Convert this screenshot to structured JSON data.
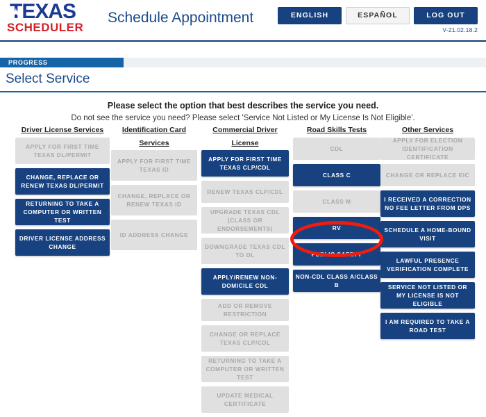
{
  "header": {
    "logo_texas": "TEXAS",
    "logo_star": "★",
    "logo_scheduler": "SCHEDULER",
    "page_heading": "Schedule Appointment",
    "english_label": "ENGLISH",
    "espanol_label": "ESPAÑOL",
    "logout_label": "LOG OUT",
    "version": "V-21.02.18.2",
    "accent_blue": "#18427f",
    "accent_red": "#d42027"
  },
  "progress": {
    "label": "PROGRESS",
    "section_title": "Select Service",
    "fill_percent": 25,
    "fill_color": "#1664a8"
  },
  "instructions": {
    "main": "Please select the option that best describes the service you need.",
    "sub": "Do not see the service you need? Please select 'Service Not Listed or My License Is Not Eligible'."
  },
  "annotation": {
    "type": "ellipse-highlight",
    "target": "RV",
    "color": "#f21c0d"
  },
  "columns": [
    {
      "id": "driver-license-services",
      "heading": "Driver License Services",
      "heading_line2": "",
      "buttons": [
        {
          "label": "APPLY FOR FIRST TIME TEXAS DL/PERMIT",
          "enabled": false
        },
        {
          "label": "CHANGE, REPLACE OR RENEW TEXAS DL/PERMIT",
          "enabled": true
        },
        {
          "label": "RETURNING TO TAKE A COMPUTER OR WRITTEN TEST",
          "enabled": true
        },
        {
          "label": "DRIVER LICENSE ADDRESS CHANGE",
          "enabled": true
        }
      ]
    },
    {
      "id": "identification-card-services",
      "heading": "Identification Card",
      "heading_line2": "Services",
      "buttons": [
        {
          "label": "APPLY FOR FIRST TIME TEXAS ID",
          "enabled": false
        },
        {
          "label": "CHANGE, REPLACE OR RENEW TEXAS ID",
          "enabled": false
        },
        {
          "label": "ID ADDRESS CHANGE",
          "enabled": false
        }
      ]
    },
    {
      "id": "commercial-driver-license-services",
      "heading": "Commercial Driver License",
      "heading_line2": "Services",
      "buttons": [
        {
          "label": "APPLY FOR FIRST TIME TEXAS CLP/CDL",
          "enabled": true
        },
        {
          "label": "RENEW TEXAS CLP/CDL",
          "enabled": false
        },
        {
          "label": "UPGRADE TEXAS CDL (CLASS OR ENDORSEMENTS)",
          "enabled": false
        },
        {
          "label": "DOWNGRADE TEXAS CDL TO DL",
          "enabled": false
        },
        {
          "label": "APPLY/RENEW NON-DOMICILE CDL",
          "enabled": true
        },
        {
          "label": "ADD OR REMOVE RESTRICTION",
          "enabled": false
        },
        {
          "label": "CHANGE OR REPLACE TEXAS CLP/CDL",
          "enabled": false
        },
        {
          "label": "RETURNING TO TAKE A COMPUTER OR WRITTEN TEST",
          "enabled": false
        },
        {
          "label": "UPDATE MEDICAL CERTIFICATE",
          "enabled": false
        }
      ]
    },
    {
      "id": "road-skills-tests",
      "heading": "Road Skills Tests",
      "heading_line2": "",
      "buttons": [
        {
          "label": "CDL",
          "enabled": false
        },
        {
          "label": "CLASS C",
          "enabled": true
        },
        {
          "label": "CLASS M",
          "enabled": false
        },
        {
          "label": "RV",
          "enabled": true
        },
        {
          "label": "PUBLIC SAFETY",
          "enabled": true
        },
        {
          "label": "NON-CDL CLASS A/CLASS B",
          "enabled": true
        }
      ]
    },
    {
      "id": "other-services",
      "heading": "Other Services",
      "heading_line2": "",
      "buttons": [
        {
          "label": "APPLY FOR ELECTION IDENTIFICATION CERTIFICATE",
          "enabled": false
        },
        {
          "label": "CHANGE OR REPLACE EIC",
          "enabled": false
        },
        {
          "label": "I RECEIVED A CORRECTION NO FEE LETTER FROM DPS",
          "enabled": true
        },
        {
          "label": "SCHEDULE A HOME-BOUND VISIT",
          "enabled": true
        },
        {
          "label": "LAWFUL PRESENCE VERIFICATION COMPLETE",
          "enabled": true
        },
        {
          "label": "SERVICE NOT LISTED OR MY LICENSE IS NOT ELIGIBLE",
          "enabled": true
        },
        {
          "label": "I AM REQUIRED TO TAKE A ROAD TEST",
          "enabled": true
        }
      ]
    }
  ]
}
